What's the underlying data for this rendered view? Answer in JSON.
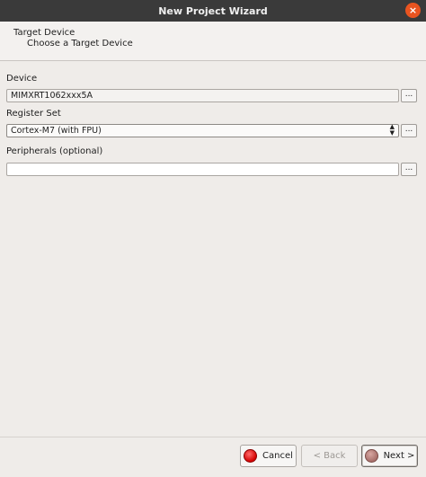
{
  "window": {
    "title": "New Project Wizard",
    "close_glyph": "×"
  },
  "header": {
    "title": "Target Device",
    "subtitle": "Choose a Target Device"
  },
  "device": {
    "label": "Device",
    "value": "MIMXRT1062xxx5A",
    "browse_label": "..."
  },
  "register_set": {
    "label": "Register Set",
    "value": "Cortex-M7 (with FPU)",
    "browse_label": "..."
  },
  "peripherals": {
    "label": "Peripherals (optional)",
    "value": "",
    "browse_label": "..."
  },
  "buttons": {
    "cancel": "Cancel",
    "back": "< Back",
    "next": "Next >"
  },
  "colors": {
    "titlebar": "#3a3a3a",
    "close": "#e95420",
    "cancel_icon": "#d40000"
  }
}
